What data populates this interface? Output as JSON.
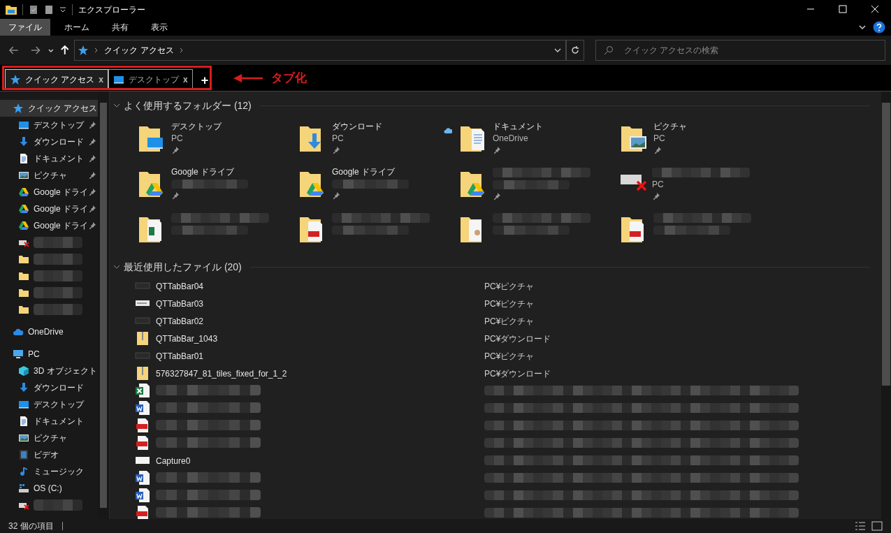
{
  "window": {
    "title": "エクスプローラー"
  },
  "ribbon_tabs": [
    {
      "label": "ファイル",
      "selected": true
    },
    {
      "label": "ホーム",
      "selected": false
    },
    {
      "label": "共有",
      "selected": false
    },
    {
      "label": "表示",
      "selected": false
    }
  ],
  "address": {
    "path": [
      "クイック アクセス"
    ]
  },
  "search": {
    "placeholder": "クイック アクセスの検索"
  },
  "tabs": [
    {
      "label": "クイック アクセス",
      "kind": "star",
      "selected": true,
      "close": "x"
    },
    {
      "label": "デスクトップ",
      "kind": "desktop",
      "selected": false,
      "close": "x"
    }
  ],
  "new_tab": "+",
  "annotation": {
    "label": "タブ化"
  },
  "sidebar": {
    "items": [
      {
        "label": "クイック アクセス",
        "kind": "star",
        "selected": true,
        "pinned": false,
        "children": [
          {
            "label": "デスクトップ",
            "kind": "desktop",
            "selected": false,
            "pinned": true
          },
          {
            "label": "ダウンロード",
            "kind": "download",
            "selected": false,
            "pinned": true
          },
          {
            "label": "ドキュメント",
            "kind": "document",
            "selected": false,
            "pinned": true
          },
          {
            "label": "ピクチャ",
            "kind": "picture",
            "selected": false,
            "pinned": true
          },
          {
            "label": "Google ドライ",
            "kind": "gdrive",
            "selected": false,
            "pinned": true
          },
          {
            "label": "Google ドライ",
            "kind": "gdrive",
            "selected": false,
            "pinned": true
          },
          {
            "label": "Google ドライ",
            "kind": "gdrive",
            "selected": false,
            "pinned": true
          },
          {
            "kind": "netdrive",
            "selected": false,
            "pinned": false
          },
          {
            "kind": "folder",
            "selected": false,
            "pinned": false
          },
          {
            "kind": "folder",
            "selected": false,
            "pinned": false
          },
          {
            "kind": "folder",
            "selected": false,
            "pinned": false
          },
          {
            "kind": "folder",
            "selected": false,
            "pinned": false
          }
        ]
      },
      {
        "label": "OneDrive",
        "kind": "cloud",
        "selected": false,
        "pinned": false
      },
      {
        "label": "PC",
        "kind": "pc",
        "selected": false,
        "pinned": false,
        "children": [
          {
            "label": "3D オブジェクト",
            "kind": "cube",
            "selected": false,
            "pinned": false
          },
          {
            "label": "ダウンロード",
            "kind": "download",
            "selected": false,
            "pinned": false
          },
          {
            "label": "デスクトップ",
            "kind": "desktop",
            "selected": false,
            "pinned": false
          },
          {
            "label": "ドキュメント",
            "kind": "document",
            "selected": false,
            "pinned": false
          },
          {
            "label": "ピクチャ",
            "kind": "picture",
            "selected": false,
            "pinned": false
          },
          {
            "label": "ビデオ",
            "kind": "video",
            "selected": false,
            "pinned": false
          },
          {
            "label": "ミュージック",
            "kind": "music",
            "selected": false,
            "pinned": false
          },
          {
            "label": "OS (C:)",
            "kind": "osdrive",
            "selected": false,
            "pinned": false
          },
          {
            "kind": "netdrive",
            "selected": false,
            "pinned": false
          }
        ]
      }
    ]
  },
  "frequent_folders": {
    "title": "よく使用するフォルダー (12)",
    "expanded": true,
    "items": [
      {
        "name": "デスクトップ",
        "location": "PC",
        "kind": "desktop",
        "pinned": true,
        "cloud": false
      },
      {
        "name": "ダウンロード",
        "location": "PC",
        "kind": "download",
        "pinned": true,
        "cloud": false
      },
      {
        "name": "ドキュメント",
        "location": "OneDrive",
        "kind": "document",
        "pinned": true,
        "cloud": true
      },
      {
        "name": "ピクチャ",
        "location": "PC",
        "kind": "picture",
        "pinned": true,
        "cloud": false
      },
      {
        "name": "Google ドライブ",
        "kind": "gdrive",
        "pinned": true,
        "cloud": false
      },
      {
        "name": "Google ドライブ",
        "kind": "gdrive",
        "pinned": true,
        "cloud": false
      },
      {
        "kind": "gdrive",
        "pinned": true,
        "cloud": false
      },
      {
        "location": "PC",
        "kind": "netdrive",
        "pinned": true,
        "cloud": false
      },
      {
        "kind": "sheet",
        "pinned": false,
        "cloud": false
      },
      {
        "kind": "pdf",
        "pinned": false,
        "cloud": false
      },
      {
        "kind": "paper",
        "pinned": false,
        "cloud": false
      },
      {
        "kind": "pdf",
        "pinned": false,
        "cloud": false
      }
    ]
  },
  "recent_files": {
    "title": "最近使用したファイル (20)",
    "expanded": true,
    "items": [
      {
        "name": "QTTabBar04",
        "location": "PC¥ピクチャ",
        "kind": "image-dark"
      },
      {
        "name": "QTTabBar03",
        "location": "PC¥ピクチャ",
        "kind": "image-light"
      },
      {
        "name": "QTTabBar02",
        "location": "PC¥ピクチャ",
        "kind": "image-dark"
      },
      {
        "name": "QTTabBar_1043",
        "location": "PC¥ダウンロード",
        "kind": "zip"
      },
      {
        "name": "QTTabBar01",
        "location": "PC¥ピクチャ",
        "kind": "image-dark"
      },
      {
        "name": "576327847_81_tiles_fixed_for_1_2",
        "location": "PC¥ダウンロード",
        "kind": "zip"
      },
      {
        "kind": "excel"
      },
      {
        "kind": "word"
      },
      {
        "kind": "pdf"
      },
      {
        "kind": "pdf"
      },
      {
        "name": "Capture0",
        "kind": "image-white"
      },
      {
        "kind": "word"
      },
      {
        "kind": "word"
      },
      {
        "kind": "pdf"
      }
    ]
  },
  "status_bar": {
    "count": "32 個の項目"
  }
}
